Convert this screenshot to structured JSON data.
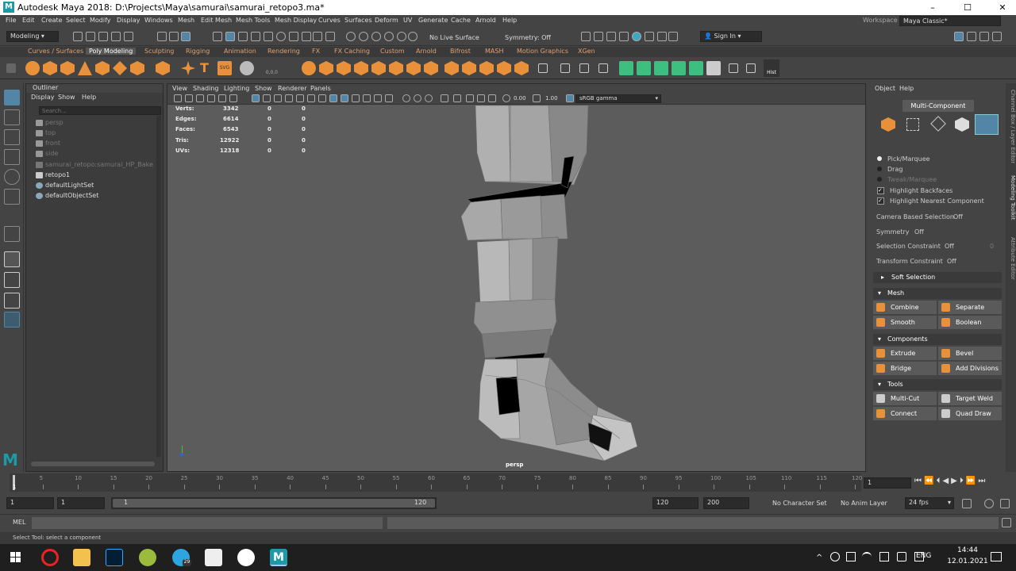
{
  "title": {
    "text": "Autodesk Maya 2018: D:\\Projects\\Maya\\samurai\\samurai_retopo3.ma*",
    "minimize": "–",
    "maximize": "☐",
    "close": "✕"
  },
  "menu": [
    "File",
    "Edit",
    "Create",
    "Select",
    "Modify",
    "Display",
    "Windows",
    "Mesh",
    "Edit Mesh",
    "Mesh Tools",
    "Mesh Display",
    "Curves",
    "Surfaces",
    "Deform",
    "UV",
    "Generate",
    "Cache",
    "Arnold",
    "Help"
  ],
  "workspace": {
    "label": "Workspace :",
    "value": "Maya Classic*"
  },
  "status": {
    "mode": "Modeling",
    "live_surface": "No Live Surface",
    "symmetry": "Symmetry: Off",
    "sign_in": "Sign In"
  },
  "shelf_tabs": [
    "Curves / Surfaces",
    "Poly Modeling",
    "Sculpting",
    "Rigging",
    "Animation",
    "Rendering",
    "FX",
    "FX Caching",
    "Custom",
    "Arnold",
    "Bifrost",
    "MASH",
    "Motion Graphics",
    "XGen"
  ],
  "shelf_active": "Poly Modeling",
  "shelf_icon_text": {
    "text_tool": "T",
    "svg": "SVG",
    "hist": "Hist",
    "uv_snap": "0,0,0"
  },
  "outliner": {
    "title": "Outliner",
    "menu": [
      "Display",
      "Show",
      "Help"
    ],
    "search_placeholder": "Search...",
    "items": [
      {
        "name": "persp",
        "dim": true
      },
      {
        "name": "top",
        "dim": true
      },
      {
        "name": "front",
        "dim": true
      },
      {
        "name": "side",
        "dim": true
      },
      {
        "name": "samurai_retopo:samurai_HP_Bake",
        "dim": true
      },
      {
        "name": "retopo1",
        "dim": false
      },
      {
        "name": "defaultLightSet",
        "dim": false
      },
      {
        "name": "defaultObjectSet",
        "dim": false
      }
    ]
  },
  "viewport": {
    "menu": [
      "View",
      "Shading",
      "Lighting",
      "Show",
      "Renderer",
      "Panels"
    ],
    "exposure": "0.00",
    "gamma": "1.00",
    "color_space": "sRGB gamma",
    "camera_label": "persp",
    "hud": [
      {
        "label": "Verts:",
        "value": "3342",
        "c1": "0",
        "c2": "0"
      },
      {
        "label": "Edges:",
        "value": "6614",
        "c1": "0",
        "c2": "0"
      },
      {
        "label": "Faces:",
        "value": "6543",
        "c1": "0",
        "c2": "0"
      },
      {
        "label": "Tris:",
        "value": "12922",
        "c1": "0",
        "c2": "0"
      },
      {
        "label": "UVs:",
        "value": "12318",
        "c1": "0",
        "c2": "0"
      }
    ]
  },
  "modeling_toolkit": {
    "menu": [
      "Object",
      "Help"
    ],
    "mode": "Multi-Component",
    "selection_options": [
      "Pick/Marquee",
      "Drag",
      "Tweak/Marquee"
    ],
    "checks": [
      "Highlight Backfaces",
      "Highlight Nearest Component"
    ],
    "camera_based_selection": {
      "label": "Camera Based Selection",
      "value": "Off"
    },
    "symmetry": {
      "label": "Symmetry",
      "value": "Off"
    },
    "selection_constraint": {
      "label": "Selection Constraint",
      "value": "Off",
      "amount": "0"
    },
    "transform_constraint": {
      "label": "Transform Constraint",
      "value": "Off"
    },
    "soft_selection": "Soft Selection",
    "sections": {
      "mesh": {
        "title": "Mesh",
        "buttons": [
          "Combine",
          "Separate",
          "Smooth",
          "Boolean"
        ]
      },
      "components": {
        "title": "Components",
        "buttons": [
          "Extrude",
          "Bevel",
          "Bridge",
          "Add Divisions"
        ]
      },
      "tools": {
        "title": "Tools",
        "buttons": [
          "Multi-Cut",
          "Target Weld",
          "Connect",
          "Quad Draw"
        ]
      }
    }
  },
  "side_tabs": [
    "Channel Box / Layer Editor",
    "Modeling Toolkit",
    "Attribute Editor"
  ],
  "timeline": {
    "ticks": [
      "5",
      "10",
      "15",
      "20",
      "25",
      "30",
      "35",
      "40",
      "45",
      "50",
      "55",
      "60",
      "65",
      "70",
      "75",
      "80",
      "85",
      "90",
      "95",
      "100",
      "105",
      "110",
      "115",
      "120"
    ],
    "first_tick": "1",
    "current_frame": "1"
  },
  "range": {
    "start": "1",
    "playback_start": "1",
    "slider_start": "1",
    "slider_end": "120",
    "playback_end": "120",
    "end": "200",
    "character_set": "No Character Set",
    "anim_layer": "No Anim Layer",
    "fps": "24 fps"
  },
  "mel": {
    "label": "MEL"
  },
  "help_line": "Select Tool: select a component",
  "taskbar": {
    "lang": "ENG",
    "time": "14:44",
    "date": "12.01.2021",
    "notif": "29"
  },
  "colors": {
    "accent": "#e8913a",
    "selected": "#5285a6",
    "bg": "#444444",
    "viewport": "#5c5c5c"
  }
}
